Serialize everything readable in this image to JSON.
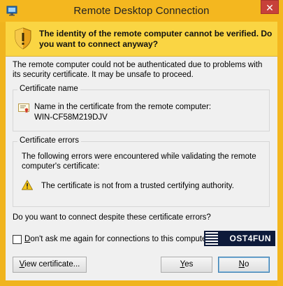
{
  "window": {
    "title": "Remote Desktop Connection",
    "close_glyph": "✕",
    "frame_color": "#f4b71f"
  },
  "banner": {
    "text": "The identity of the remote computer cannot be verified. Do you want to connect anyway?",
    "icon": "shield-warning-icon",
    "color": "#fad543"
  },
  "intro_text": "The remote computer could not be authenticated due to problems with its security certificate. It may be unsafe to proceed.",
  "certificate_name": {
    "title": "Certificate name",
    "label": "Name in the certificate from the remote computer:",
    "value": "WIN-CF58M219DJV",
    "icon": "certificate-icon"
  },
  "certificate_errors": {
    "title": "Certificate errors",
    "intro": "The following errors were encountered while validating the remote computer's certificate:",
    "items": [
      {
        "icon": "warning-icon",
        "text": "The certificate is not from a trusted certifying authority."
      }
    ]
  },
  "question": "Do you want to connect despite these certificate errors?",
  "dont_ask": {
    "prefix": "D",
    "rest": "on't ask me again for connections to this computer",
    "checked": false
  },
  "logo_text": "OST4FUN",
  "buttons": {
    "view": {
      "accel": "V",
      "rest": "iew certificate..."
    },
    "yes": {
      "accel": "Y",
      "rest": "es"
    },
    "no": {
      "accel": "N",
      "rest": "o"
    }
  }
}
